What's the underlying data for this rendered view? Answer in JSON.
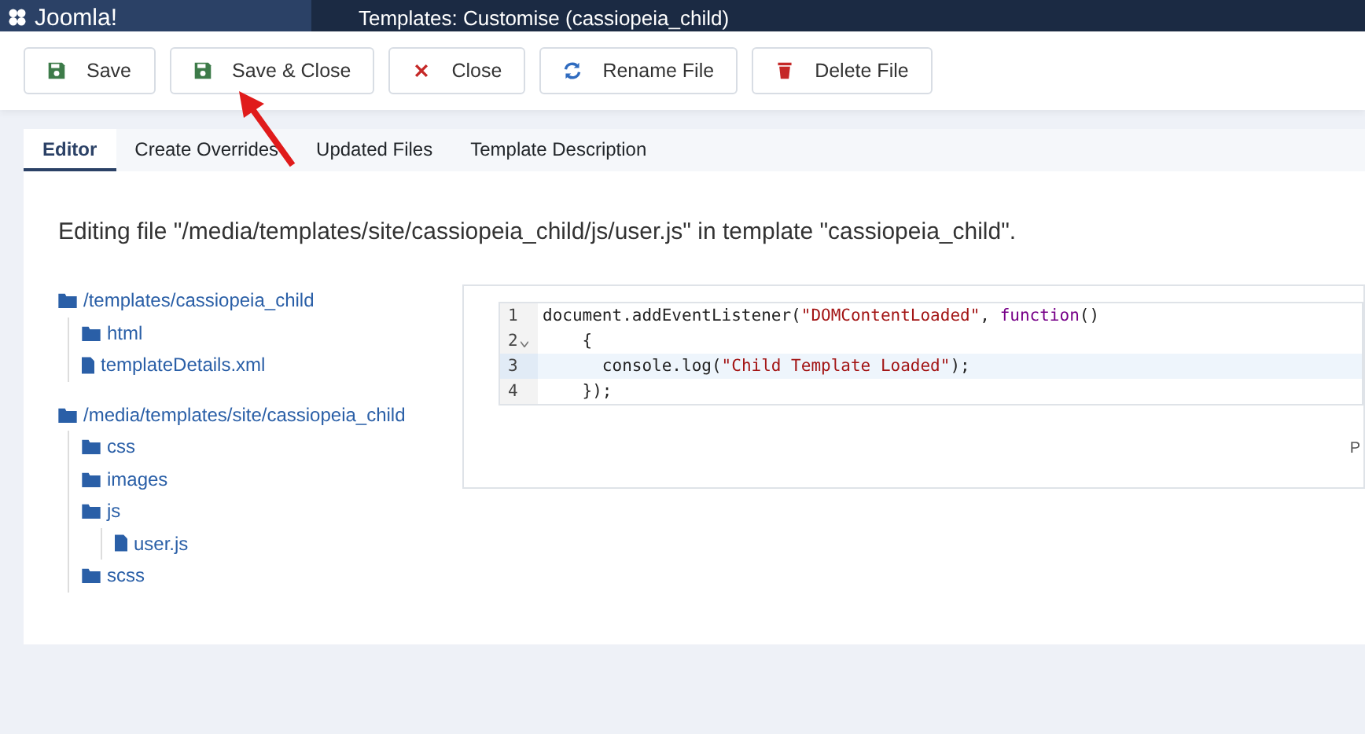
{
  "header": {
    "logo": "Joomla!",
    "title": "Templates: Customise (cassiopeia_child)"
  },
  "toolbar": [
    {
      "label": "Save",
      "kind": "save"
    },
    {
      "label": "Save & Close",
      "kind": "save"
    },
    {
      "label": "Close",
      "kind": "close"
    },
    {
      "label": "Rename File",
      "kind": "refresh"
    },
    {
      "label": "Delete File",
      "kind": "trash"
    }
  ],
  "tabs": [
    {
      "label": "Editor",
      "selected": true
    },
    {
      "label": "Create Overrides",
      "selected": false
    },
    {
      "label": "Updated Files",
      "selected": false
    },
    {
      "label": "Template Description",
      "selected": false
    }
  ],
  "editing_message": "Editing file \"/media/templates/site/cassiopeia_child/js/user.js\" in template \"cassiopeia_child\".",
  "tree": [
    {
      "label": "/templates/cassiopeia_child",
      "kind": "folder",
      "children": [
        {
          "label": "html",
          "kind": "folder"
        },
        {
          "label": "templateDetails.xml",
          "kind": "file"
        }
      ]
    },
    {
      "label": "/media/templates/site/cassiopeia_child",
      "kind": "folder",
      "children": [
        {
          "label": "css",
          "kind": "folder"
        },
        {
          "label": "images",
          "kind": "folder"
        },
        {
          "label": "js",
          "kind": "folder",
          "children": [
            {
              "label": "user.js",
              "kind": "file"
            }
          ]
        },
        {
          "label": "scss",
          "kind": "folder"
        }
      ]
    }
  ],
  "code": [
    {
      "number": "1",
      "foldable": false,
      "selected": false,
      "tokens": [
        {
          "kind": "plain",
          "text": "document.addEventListener("
        },
        {
          "kind": "string",
          "text": "\"DOMContentLoaded\""
        },
        {
          "kind": "plain",
          "text": ", "
        },
        {
          "kind": "keyword",
          "text": "function"
        },
        {
          "kind": "plain",
          "text": "()"
        }
      ]
    },
    {
      "number": "2",
      "foldable": true,
      "selected": false,
      "tokens": [
        {
          "kind": "plain",
          "text": "    {"
        }
      ]
    },
    {
      "number": "3",
      "foldable": false,
      "selected": true,
      "tokens": [
        {
          "kind": "plain",
          "text": "      console.log("
        },
        {
          "kind": "string",
          "text": "\"Child Template Loaded\""
        },
        {
          "kind": "plain",
          "text": ");"
        }
      ]
    },
    {
      "number": "4",
      "foldable": false,
      "selected": false,
      "tokens": [
        {
          "kind": "plain",
          "text": "    });"
        }
      ]
    }
  ],
  "editor_footer": "P"
}
